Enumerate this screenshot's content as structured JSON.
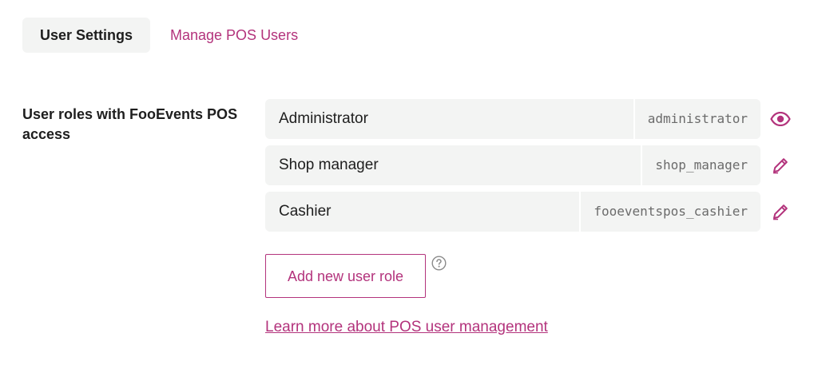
{
  "tabs": [
    {
      "label": "User Settings",
      "active": true
    },
    {
      "label": "Manage POS Users",
      "active": false
    }
  ],
  "section": {
    "label": "User roles with FooEvents POS access"
  },
  "roles": [
    {
      "name": "Administrator",
      "slug": "administrator",
      "action_icon": "eye-icon"
    },
    {
      "name": "Shop manager",
      "slug": "shop_manager",
      "action_icon": "pencil-icon"
    },
    {
      "name": "Cashier",
      "slug": "fooeventspos_cashier",
      "action_icon": "pencil-icon"
    }
  ],
  "add_button": {
    "label": "Add new user role"
  },
  "help_icon": "question-circle-icon",
  "learn_more_link": {
    "label": "Learn more about POS user management"
  },
  "colors": {
    "accent": "#b3337c",
    "row_background": "#f3f4f3",
    "text": "#1e1e1e",
    "muted": "#6b6b6b"
  }
}
